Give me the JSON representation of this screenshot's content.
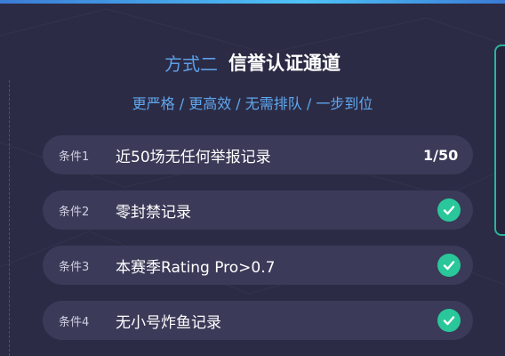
{
  "header": {
    "method_label": "方式二",
    "title": "信誉认证通道"
  },
  "subtitle": "更严格 / 更高效 / 无需排队 / 一步到位",
  "conditions": [
    {
      "tag": "条件1",
      "text": "近50场无任何举报记录",
      "status": "progress",
      "progress": "1/50"
    },
    {
      "tag": "条件2",
      "text": "零封禁记录",
      "status": "done",
      "icon": "check-circle-icon"
    },
    {
      "tag": "条件3",
      "text": "本赛季Rating Pro>0.7",
      "status": "done",
      "icon": "check-circle-icon"
    },
    {
      "tag": "条件4",
      "text": "无小号炸鱼记录",
      "status": "done",
      "icon": "check-circle-icon"
    }
  ],
  "colors": {
    "background": "#2c2b45",
    "row_background": "#3b3a58",
    "accent_blue": "#5b9fe8",
    "check_green": "#29c79a"
  }
}
